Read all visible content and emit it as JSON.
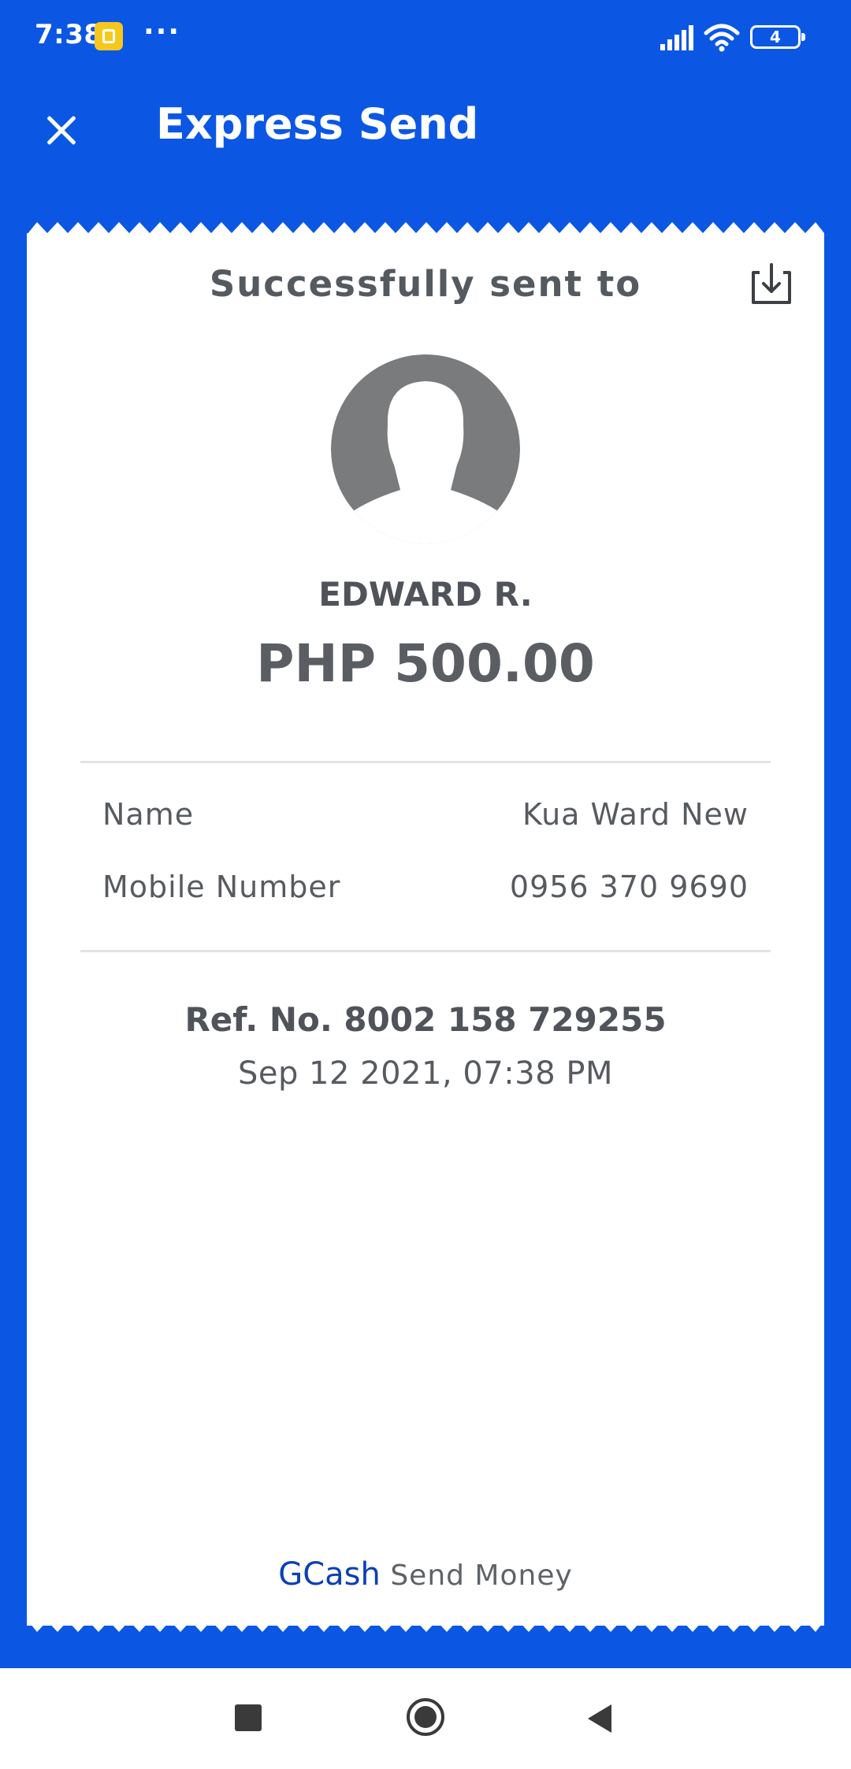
{
  "status_bar": {
    "time": "7:38",
    "more": "···",
    "battery_level": "4",
    "icons": [
      "notification-app-icon",
      "signal-icon",
      "wifi-icon",
      "battery-icon"
    ]
  },
  "header": {
    "title": "Express Send",
    "close_icon": "close-icon"
  },
  "receipt": {
    "success_label": "Successfully sent to",
    "download_icon": "download-icon",
    "avatar_icon": "person-silhouette-icon",
    "recipient_name": "EDWARD R.",
    "amount": "PHP 500.00",
    "details": [
      {
        "label": "Name",
        "value": "Kua Ward New"
      },
      {
        "label": "Mobile Number",
        "value": "0956 370 9690"
      }
    ],
    "ref_number": "Ref. No. 8002 158 729255",
    "datetime": "Sep 12 2021, 07:38 PM",
    "footer": {
      "brand": "GCash",
      "service": "Send Money"
    }
  },
  "nav_bar": {
    "buttons": [
      "recents-square-icon",
      "home-circle-icon",
      "back-triangle-icon"
    ]
  },
  "colors": {
    "brand_blue": "#0b57e3",
    "gcash_blue": "#0b3fb5",
    "text_gray": "#575b60",
    "avatar_gray": "#7a7b7c"
  }
}
